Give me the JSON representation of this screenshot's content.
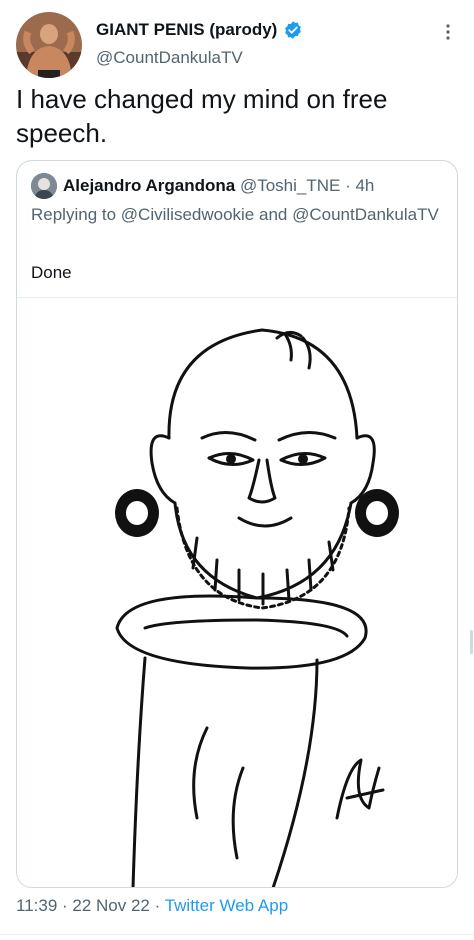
{
  "tweet": {
    "author_name": "GIANT PENIS (parody)",
    "author_handle": "@CountDankulaTV",
    "verified_icon": "verified-badge-icon",
    "text": "I have changed my mind on free speech.",
    "timestamp": "11:39 · 22 Nov 22 ·",
    "source": "Twitter Web App"
  },
  "quoted": {
    "author_name": "Alejandro Argandona",
    "author_handle": "@Toshi_TNE",
    "age": "· 4h",
    "replying_prefix": "Replying to",
    "reply_user_1": "@Civilisedwookie",
    "reply_joiner": "and",
    "reply_user_2": "@CountDankulaTV",
    "text": "Done"
  },
  "colors": {
    "accent": "#1d9bf0",
    "secondary_text": "#536471",
    "primary_text": "#0f1419",
    "border": "#cfd9de"
  }
}
